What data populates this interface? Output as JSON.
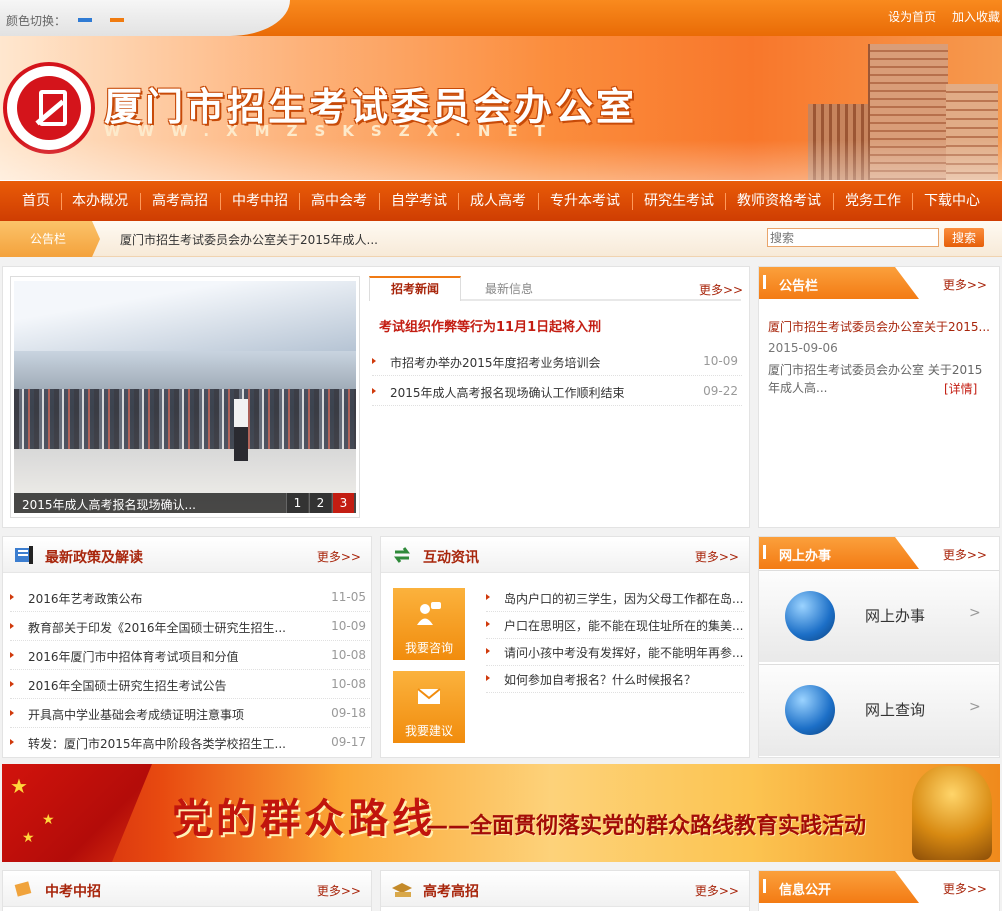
{
  "topbar": {
    "color_switch_label": "颜色切换：",
    "set_home": "设为首页",
    "add_favorite": "加入收藏"
  },
  "header": {
    "title": "厦门市招生考试委员会办公室",
    "url": "WWW.XMZSKSZX.NET"
  },
  "nav": {
    "items": [
      "首页",
      "本办概况",
      "高考高招",
      "中考中招",
      "高中会考",
      "自学考试",
      "成人高考",
      "专升本考试",
      "研究生考试",
      "教师资格考试",
      "党务工作",
      "下载中心"
    ]
  },
  "notice_bar": {
    "label": "公告栏",
    "text": "厦门市招生考试委员会办公室关于2015年成人...",
    "search_placeholder": "搜索",
    "search_button": "搜索"
  },
  "slideshow": {
    "caption": "2015年成人高考报名现场确认...",
    "pages": [
      "1",
      "2",
      "3"
    ],
    "active_page": 3
  },
  "news": {
    "tabs": [
      "招考新闻",
      "最新信息"
    ],
    "more": "更多>>",
    "headline": "考试组织作弊等行为11月1日起将入刑",
    "items": [
      {
        "title": "市招考办举办2015年度招考业务培训会",
        "date": "10-09"
      },
      {
        "title": "2015年成人高考报名现场确认工作顺利结束",
        "date": "09-22"
      }
    ]
  },
  "announcement": {
    "title": "公告栏",
    "more": "更多>>",
    "item_title": "厦门市招生考试委员会办公室关于2015...",
    "item_date": "2015-09-06",
    "item_text": "厦门市招生考试委员会办公室 关于2015年成人高...",
    "detail": "[详情]"
  },
  "policy": {
    "title": "最新政策及解读",
    "more": "更多>>",
    "items": [
      {
        "title": "2016年艺考政策公布",
        "date": "11-05"
      },
      {
        "title": "教育部关于印发《2016年全国硕士研究生招生...",
        "date": "10-09"
      },
      {
        "title": "2016年厦门市中招体育考试项目和分值",
        "date": "10-08"
      },
      {
        "title": "2016年全国硕士研究生招生考试公告",
        "date": "10-08"
      },
      {
        "title": "开具高中学业基础会考成绩证明注意事项",
        "date": "09-18"
      },
      {
        "title": "转发：厦门市2015年高中阶段各类学校招生工...",
        "date": "09-17"
      }
    ]
  },
  "interactive": {
    "title": "互动资讯",
    "more": "更多>>",
    "consult": "我要咨询",
    "suggest": "我要建议",
    "items": [
      "岛内户口的初三学生，因为父母工作都在岛...",
      "户口在思明区，能不能在现住址所在的集美...",
      "请问小孩中考没有发挥好，能不能明年再参...",
      "如何参加自考报名？什么时候报名？"
    ]
  },
  "online": {
    "title": "网上办事",
    "more": "更多>>",
    "items": [
      "网上办事",
      "网上查询"
    ]
  },
  "banner": {
    "big_text": "党的群众路线",
    "sub_text": "——全面贯彻落实党的群众路线教育实践活动"
  },
  "bottom": {
    "zhongkao": {
      "title": "中考中招",
      "more": "更多>>"
    },
    "gaokao": {
      "title": "高考高招",
      "more": "更多>>"
    },
    "info": {
      "title": "信息公开",
      "more": "更多>>"
    }
  },
  "colors": {
    "brand_orange": "#f07a14",
    "nav_red": "#cf3d02",
    "title_red": "#a8260c",
    "alert_red": "#c31d12"
  }
}
